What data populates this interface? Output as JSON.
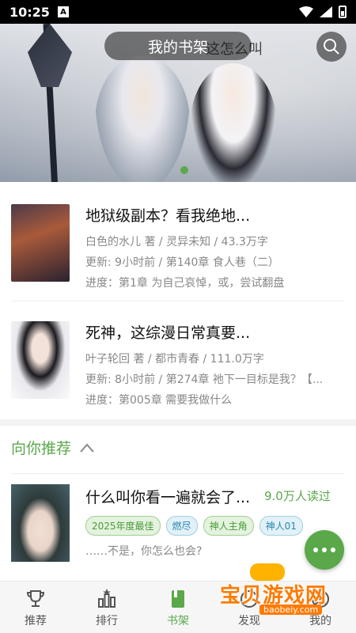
{
  "status_bar": {
    "time": "10:25",
    "badge": "A"
  },
  "banner": {
    "title": "我的书架",
    "calligraphy": "这怎么叫"
  },
  "bookshelf": [
    {
      "title": "地狱级副本？看我绝地...",
      "meta": "白色的水儿 著 / 灵异未知 / 43.3万字",
      "update": "更新: 9小时前 / 第140章 食人巷（二）",
      "progress": "进度：第1章 为自己哀悼，或，尝试翻盘"
    },
    {
      "title": "死神，这综漫日常真要...",
      "meta": "叶子轮回 著 / 都市青春 / 111.0万字",
      "update": "更新: 8小时前 / 第274章 祂下一目标是我？【...",
      "progress": "进度：第005章 需要我做什么"
    }
  ],
  "recommend": {
    "header": "向你推荐",
    "book": {
      "title": "什么叫你看一遍就会了...",
      "reads": "9.0万人读过",
      "tags": [
        "2025年度最佳",
        "燃尽",
        "神人主角",
        "神人01"
      ],
      "snippet": "……不是，你怎么也会?"
    }
  },
  "bottom_nav": [
    {
      "label": "推荐",
      "icon": "trophy-icon"
    },
    {
      "label": "排行",
      "icon": "ranking-icon"
    },
    {
      "label": "书架",
      "icon": "bookshelf-icon"
    },
    {
      "label": "发现",
      "icon": "compass-icon"
    },
    {
      "label": "我的",
      "icon": "user-icon"
    }
  ],
  "watermark": {
    "text": "宝贝游戏网",
    "url": "baobeiy.com"
  },
  "colors": {
    "accent": "#5aa84a",
    "tag_green": "#4a9a3a",
    "tag_blue": "#2a86b0"
  }
}
